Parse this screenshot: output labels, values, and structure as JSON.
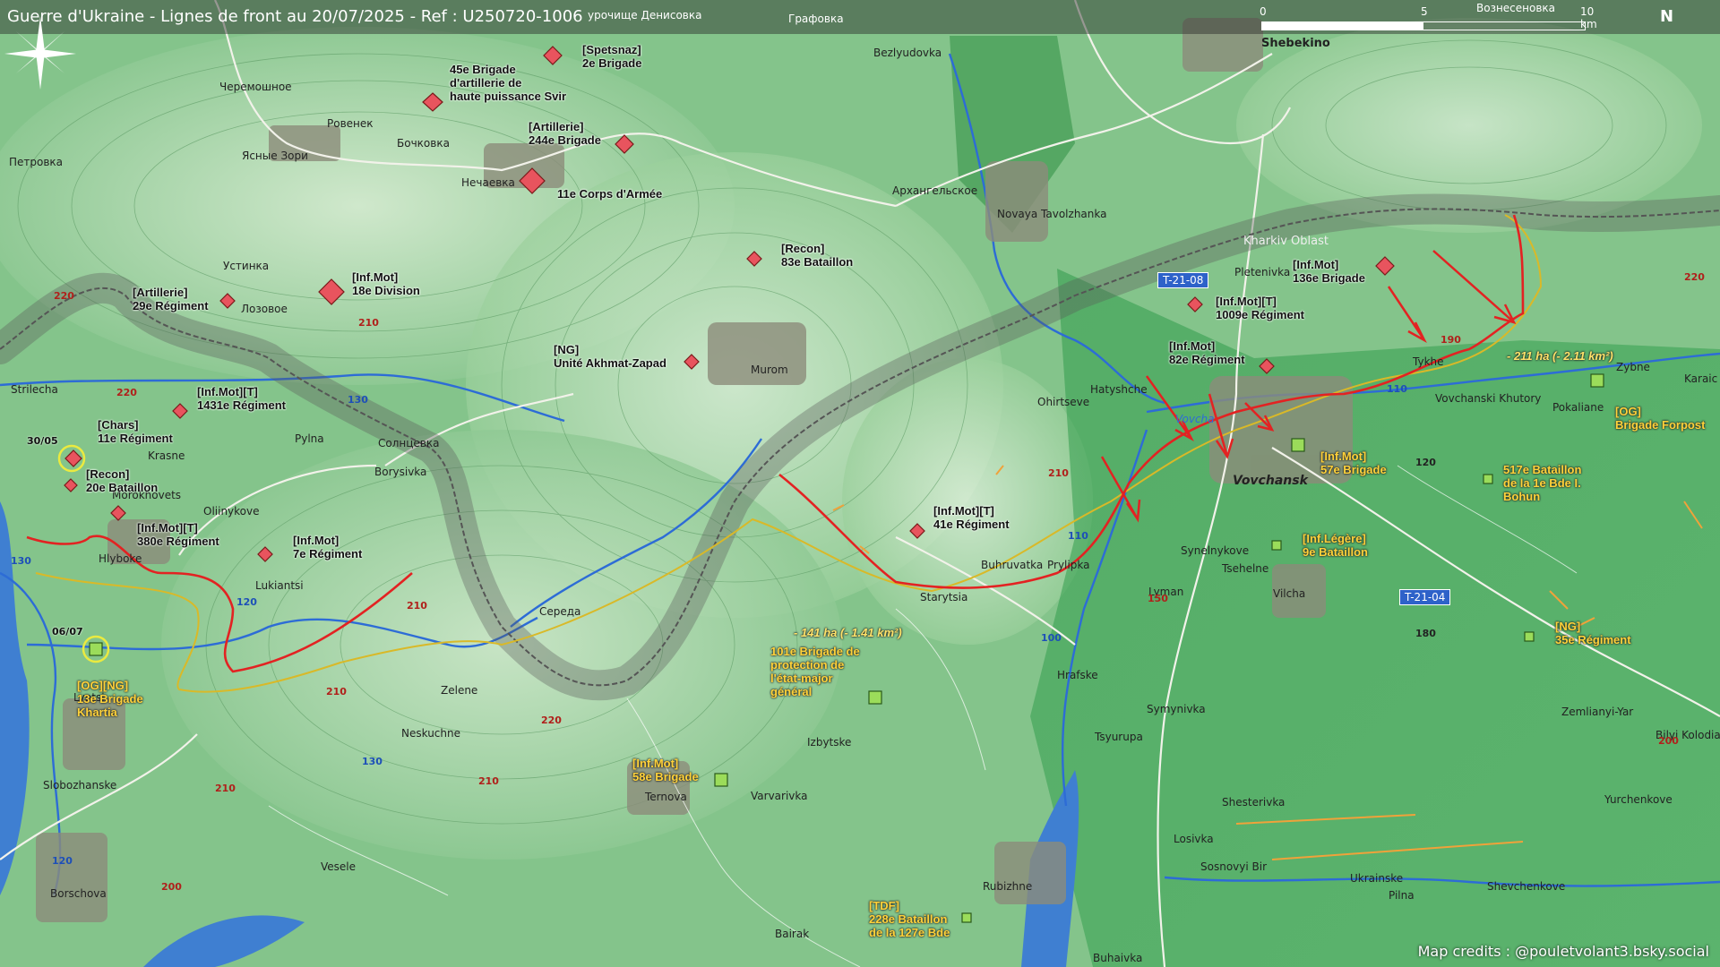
{
  "title": "Guerre d'Ukraine - Lignes de front au 20/07/2025 - Ref : U250720-1006",
  "credits": "Map credits : @pouletvolant3.bsky.social",
  "scale": {
    "l0": "0",
    "l5": "5",
    "l10": "10 km"
  },
  "north": "N",
  "colors": {
    "russian": "#e8545e",
    "ukrainian": "#9bdc5a",
    "front": "#e32222",
    "border": "#6b6b6b"
  },
  "places": {
    "shebekino": "Shebekino",
    "bezlyudovka": "Bezlyudovka",
    "grafovka": "Графовка",
    "voznesenovka": "Вознесеновка",
    "urochische": "урочище Денисовка",
    "cheremoshnoe": "Черемошное",
    "rovenek": "Ровенек",
    "bochkovka": "Бочковка",
    "yasnye": "Ясные Зори",
    "petrovka": "Петровка",
    "nechaevka": "Нечаевка",
    "arkhangelskoe": "Архангельское",
    "novaya": "Novaya Tavolzhanka",
    "ustinka": "Устинка",
    "lozovoe": "Лозовое",
    "murom": "Murom",
    "strilecha": "Strilecha",
    "krasne": "Krasne",
    "morokhovets": "Morokhovets",
    "oliinykove": "Oliinykove",
    "pylna": "Pylna",
    "solntsevka": "Солнцевка",
    "borysivka": "Borysivka",
    "hlyboke": "Hlyboke",
    "lukiantsi": "Lukiantsi",
    "sereda": "Середа",
    "zelene": "Zelene",
    "neskuchne": "Neskuchne",
    "lyptsi": "Lyptsi",
    "slobozhanske": "Slobozhanske",
    "borschova": "Borschova",
    "vesele": "Vesele",
    "izbytske": "Izbytske",
    "ternova": "Ternova",
    "varvarivka": "Varvarivka",
    "bairak": "Bairak",
    "rubizhne": "Rubizhne",
    "buhaivka": "Buhaivka",
    "starytsia": "Starytsia",
    "buhruvatka": "Buhruvatka",
    "prylipka": "Prylipka",
    "hatyshche": "Hatyshche",
    "ohirtseve": "Ohirtseve",
    "pletenivka": "Pletenivka",
    "kharkiv_oblast": "Kharkiv Oblast",
    "vovcha": "Vovcha",
    "vovchansk": "Vovchansk",
    "tykhe": "Tykhe",
    "vovchanski": "Vovchanski Khutory",
    "pokaliane": "Pokaliane",
    "zybne": "Zybne",
    "karaichne": "Karaic",
    "synelnykove": "Synelnykove",
    "tsehelne": "Tsehelne",
    "lyman": "Lyman",
    "vilcha": "Vilcha",
    "hrafske": "Hrafske",
    "symynivka": "Symynivka",
    "tsyurupa": "Tsyurupa",
    "shesterivka": "Shesterivka",
    "losivka": "Losivka",
    "sosnovyi": "Sosnovyi Bir",
    "ukrainske": "Ukrainske",
    "pilna": "Pilna",
    "shevchenkove": "Shevchenkove",
    "zemlianyi": "Zemlianyi-Yar",
    "bilyi": "Bilyi Kolodiaz",
    "yurchenkove": "Yurchenkove"
  },
  "roads": {
    "t2108": "T-21-08",
    "t2104": "T-21-04"
  },
  "elevations": {
    "e220": "220",
    "e210": "210",
    "e130": "130",
    "e120": "120",
    "e200": "200",
    "e150": "150",
    "e100": "100",
    "e110": "110",
    "e190": "190",
    "e180": "180"
  },
  "dates": {
    "d3005": "30/05",
    "d0607": "06/07"
  },
  "areas": {
    "a141": "- 141 ha (- 1.41 km²)",
    "a211": "- 211 ha (- 2.11 km²)"
  },
  "units_ru": {
    "spetsnaz": "[Spetsnaz]\n2e Brigade",
    "artillerie45": "45e Brigade\nd'artillerie de\nhaute puissance Svir",
    "artillerie244": "[Artillerie]\n244e Brigade",
    "corps11": "11e Corps d'Armée",
    "recon83": "[Recon]\n83e Bataillon",
    "infmot18": "[Inf.Mot]\n18e Division",
    "artillerie29": "[Artillerie]\n29e Régiment",
    "ng_akhmat": "[NG]\nUnité Akhmat-Zapad",
    "infmot1431": "[Inf.Mot][T]\n1431e Régiment",
    "chars11": "[Chars]\n11e Régiment",
    "recon20": "[Recon]\n20e Bataillon",
    "infmot380": "[Inf.Mot][T]\n380e Régiment",
    "infmot7": "[Inf.Mot]\n7e Régiment",
    "infmot41": "[Inf.Mot][T]\n41e Régiment",
    "infmot136": "[Inf.Mot]\n136e Brigade",
    "infmot1009": "[Inf.Mot][T]\n1009e Régiment",
    "infmot82": "[Inf.Mot]\n82e Régiment"
  },
  "units_ua": {
    "og_forpost": "[OG]\nBrigade Forpost",
    "infmot57": "[Inf.Mot]\n57e Brigade",
    "bat517": "517e Bataillon\nde la 1e Bde I.\nBohun",
    "inflegere9": "[Inf.Légère]\n9e Bataillon",
    "ng35": "[NG]\n35e Régiment",
    "brig101": "101e Brigade de\nprotection de\nl'état-major\ngénéral",
    "og_khartia": "[OG][NG]\n13e Brigade\nKhartia",
    "infmot58": "[Inf.Mot]\n58e Brigade",
    "tdf228": "[TDF]\n228e Bataillon\nde la 127e Bde"
  }
}
